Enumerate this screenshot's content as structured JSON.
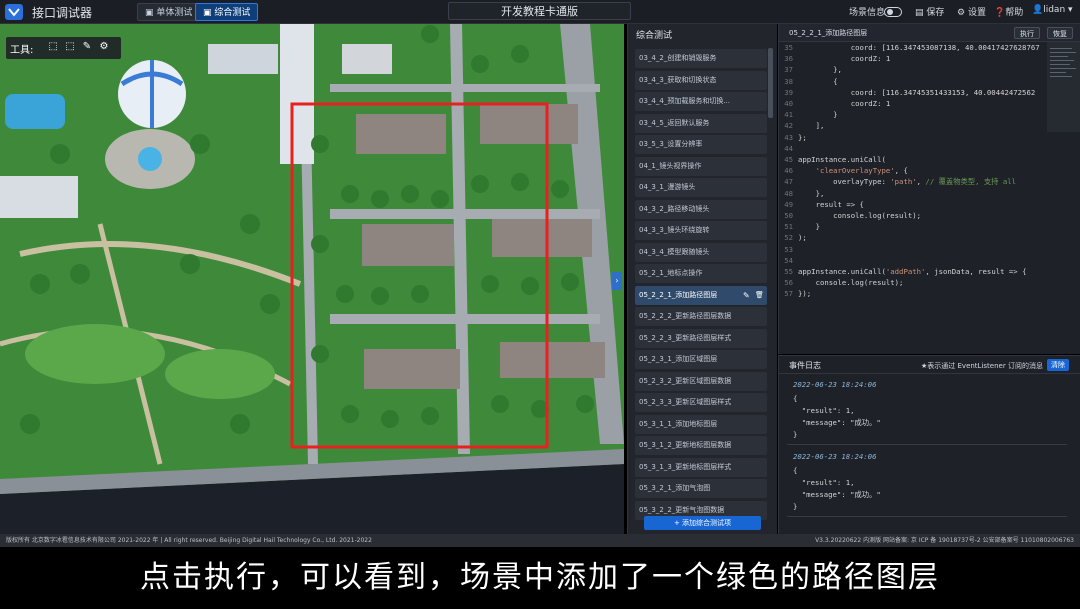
{
  "topbar": {
    "app_title": "接口调试器",
    "tabs": [
      {
        "label": "单体测试",
        "active": false
      },
      {
        "label": "综合测试",
        "active": true
      }
    ],
    "center_title": "开发教程卡通版",
    "scene_info_label": "场景信息",
    "save_label": "保存",
    "settings_label": "设置",
    "help_label": "帮助",
    "user_label": "lidan"
  },
  "scene": {
    "toolbox_label": "工具:",
    "tools": [
      "select-box-icon",
      "measure-icon",
      "draw-pen-icon",
      "settings-gear-icon"
    ],
    "highlight_color": "#e82020"
  },
  "list": {
    "header": "综合测试",
    "items": [
      "03_4_2_创建和销毁服务",
      "03_4_3_获取和切换状态",
      "03_4_4_预加载服务和切换...",
      "03_4_5_返回默认服务",
      "03_5_3_设置分辨率",
      "04_1_镜头视界操作",
      "04_3_1_漫游镜头",
      "04_3_2_路径移动镜头",
      "04_3_3_镜头环绕旋转",
      "04_3_4_模型跟随镜头",
      "05_2_1_地标点操作",
      "05_2_2_1_添加路径图层",
      "05_2_2_2_更新路径图层数据",
      "05_2_2_3_更新路径图层样式",
      "05_2_3_1_添加区域图层",
      "05_2_3_2_更新区域图层数据",
      "05_2_3_3_更新区域图层样式",
      "05_3_1_1_添加地标图层",
      "05_3_1_2_更新地标图层数据",
      "05_3_1_3_更新地标图层样式",
      "05_3_2_1_添加气泡图",
      "05_3_2_2_更新气泡图数据"
    ],
    "selected_index": 11,
    "add_button": "+ 添加综合测试项"
  },
  "editor": {
    "title": "05_2_2_1_添加路径图层",
    "run_label": "执行",
    "restore_label": "恢复",
    "lines": [
      {
        "n": "35",
        "t": "            coord: [116.347453087138, 40.00417427628767"
      },
      {
        "n": "36",
        "t": "            coordZ: 1"
      },
      {
        "n": "37",
        "t": "        },"
      },
      {
        "n": "38",
        "t": "        {"
      },
      {
        "n": "39",
        "t": "            coord: [116.34745351433153, 40.00442472562"
      },
      {
        "n": "40",
        "t": "            coordZ: 1"
      },
      {
        "n": "41",
        "t": "        }"
      },
      {
        "n": "42",
        "t": "    ],"
      },
      {
        "n": "43",
        "t": "};"
      },
      {
        "n": "44",
        "t": ""
      },
      {
        "n": "45",
        "t": "appInstance.uniCall("
      },
      {
        "n": "46",
        "t": "    'clearOverlayType', {"
      },
      {
        "n": "47",
        "t": "        overlayType: 'path', // 覆盖物类型, 支持 all"
      },
      {
        "n": "48",
        "t": "    },"
      },
      {
        "n": "49",
        "t": "    result => {"
      },
      {
        "n": "50",
        "t": "        console.log(result);"
      },
      {
        "n": "51",
        "t": "    }"
      },
      {
        "n": "52",
        "t": ");"
      },
      {
        "n": "53",
        "t": ""
      },
      {
        "n": "54",
        "t": ""
      },
      {
        "n": "55",
        "t": "appInstance.uniCall('addPath', jsonData, result => {"
      },
      {
        "n": "56",
        "t": "    console.log(result);"
      },
      {
        "n": "57",
        "t": "});"
      }
    ]
  },
  "eventlog": {
    "title": "事件日志",
    "note": "★表示通过 EventListener 订阅的消息",
    "clear_label": "清除",
    "entries": [
      {
        "time": "2022-06-23 18:24:06",
        "lines": [
          "{",
          "  \"result\": 1,",
          "  \"message\": \"成功。\"",
          "}"
        ]
      },
      {
        "time": "2022-06-23 18:24:06",
        "lines": [
          "{",
          "  \"result\": 1,",
          "  \"message\": \"成功。\"",
          "}"
        ]
      }
    ]
  },
  "footer": {
    "left": "版权所有 北京数字冰雹信息技术有限公司 2021-2022 年 | All right reserved. Beijing Digital Hail Technology Co., Ltd. 2021-2022",
    "right": "V3.3.20220622 内测版  网站备案: 京 ICP 备 19018737号-2 公安部备案号 11010802006763"
  },
  "subtitle": "点击执行，可以看到，场景中添加了一个绿色的路径图层"
}
